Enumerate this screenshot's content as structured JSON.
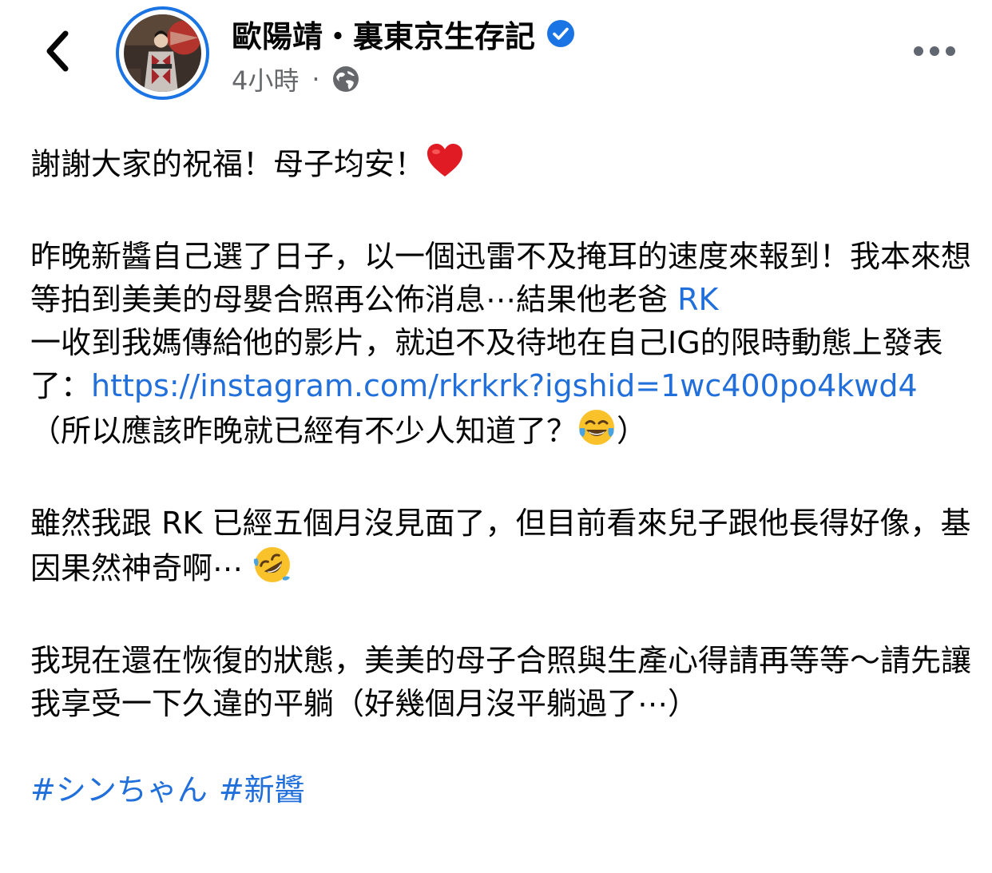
{
  "header": {
    "page_name": "歐陽靖・裏東京生存記",
    "time_ago": "4小時",
    "separator": "·",
    "icons": {
      "back": "chevron-left-icon",
      "verified": "verified-badge-icon",
      "audience": "globe-icon",
      "more": "more-horizontal-icon"
    },
    "colors": {
      "verified": "#1b74e4",
      "avatar_ring": "#1b74e4",
      "meta_text": "#65676b"
    }
  },
  "post": {
    "p1_text": "謝謝大家的祝福！母子均安！",
    "p1_emoji": "red-heart-emoji",
    "p2_text_a": "昨晚新醬自己選了日子，以一個迅雷不及掩耳的速度來報到！我本來想等拍到美美的母嬰合照再公佈消息⋯結果他老爸 ",
    "p2_mention": "RK",
    "p2_text_b": "一收到我媽傳給他的影片，就迫不及待地在自己IG的限時動態上發表了：",
    "p2_link": "https://instagram.com/rkrkrk?igshid=1wc400po4kwd4",
    "p2_text_c": "（所以應該昨晚就已經有不少人知道了？",
    "p2_emoji": "tears-of-joy-emoji",
    "p2_text_d": "）",
    "p3_text": "雖然我跟 RK 已經五個月沒見面了，但目前看來兒子跟他長得好像，基因果然神奇啊⋯ ",
    "p3_emoji": "rolling-on-floor-laughing-emoji",
    "p4_text": "我現在還在恢復的狀態，美美的母子合照與生產心得請再等等～請先讓我享受一下久違的平躺（好幾個月沒平躺過了⋯）",
    "hashtags": [
      "#シンちゃん",
      "#新醬"
    ],
    "colors": {
      "link": "#216fdb",
      "text": "#050505"
    }
  }
}
